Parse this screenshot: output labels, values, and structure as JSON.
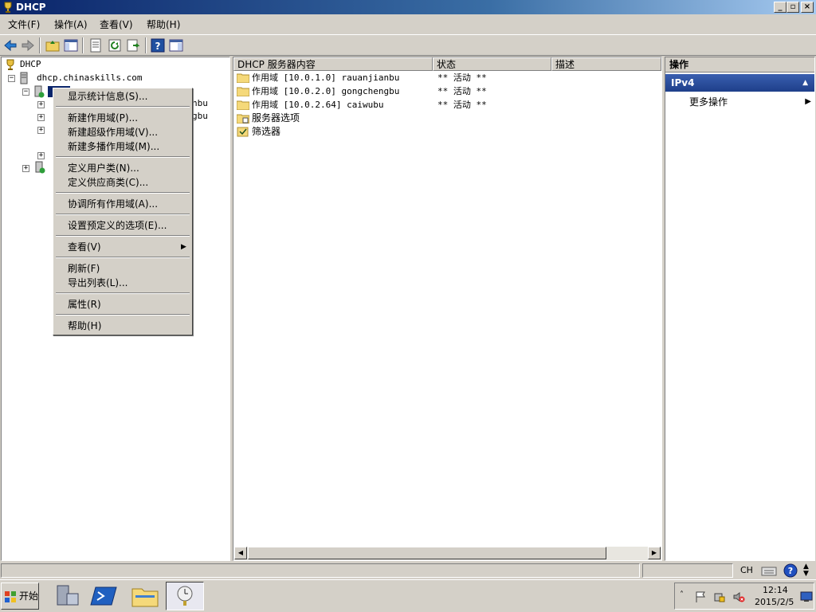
{
  "window": {
    "title": "DHCP"
  },
  "menu": [
    "文件(F)",
    "操作(A)",
    "查看(V)",
    "帮助(H)"
  ],
  "tree": {
    "root": "DHCP",
    "server": "dhcp.chinaskills.com",
    "partial_rows": [
      "nbu",
      "gbu"
    ]
  },
  "list": {
    "columns": [
      "DHCP 服务器内容",
      "状态",
      "描述"
    ],
    "rows": [
      {
        "name": "作用域 [10.0.1.0] rauanjianbu",
        "status": "** 活动 **"
      },
      {
        "name": "作用域 [10.0.2.0] gongchengbu",
        "status": "** 活动 **"
      },
      {
        "name": "作用域 [10.0.2.64] caiwubu",
        "status": "** 活动 **"
      },
      {
        "name": "服务器选项",
        "status": ""
      },
      {
        "name": "筛选器",
        "status": ""
      }
    ]
  },
  "actions": {
    "header": "操作",
    "section": "IPv4",
    "more": "更多操作"
  },
  "context_menu": {
    "items": [
      "显示统计信息(S)...",
      "新建作用域(P)...",
      "新建超级作用域(V)...",
      "新建多播作用域(M)...",
      "定义用户类(N)...",
      "定义供应商类(C)...",
      "协调所有作用域(A)...",
      "设置预定义的选项(E)...",
      "查看(V)",
      "刷新(F)",
      "导出列表(L)...",
      "属性(R)",
      "帮助(H)"
    ]
  },
  "taskbar": {
    "start": "开始",
    "lang": "CH",
    "time": "12:14",
    "date": "2015/2/5"
  },
  "colors": {
    "title_bar": "#0a246a",
    "action_band": "#1e3f8a",
    "status_ok": "#2e9e3a"
  }
}
